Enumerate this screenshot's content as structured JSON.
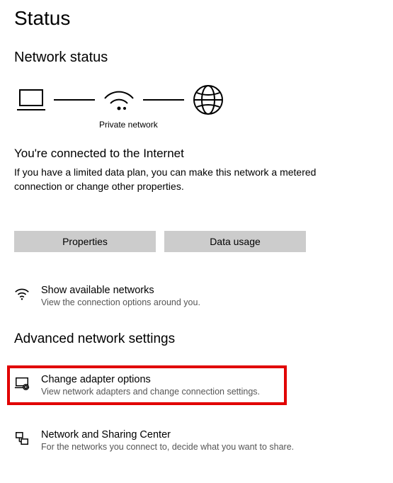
{
  "page_title": "Status",
  "network_status_heading": "Network status",
  "private_network_label": "Private network",
  "connected_heading": "You're connected to the Internet",
  "connected_description": "If you have a limited data plan, you can make this network a metered connection or change other properties.",
  "properties_button": "Properties",
  "data_usage_button": "Data usage",
  "show_available": {
    "title": "Show available networks",
    "desc": "View the connection options around you."
  },
  "advanced_heading": "Advanced network settings",
  "change_adapter": {
    "title": "Change adapter options",
    "desc": "View network adapters and change connection settings."
  },
  "sharing_center": {
    "title": "Network and Sharing Center",
    "desc": "For the networks you connect to, decide what you want to share."
  }
}
